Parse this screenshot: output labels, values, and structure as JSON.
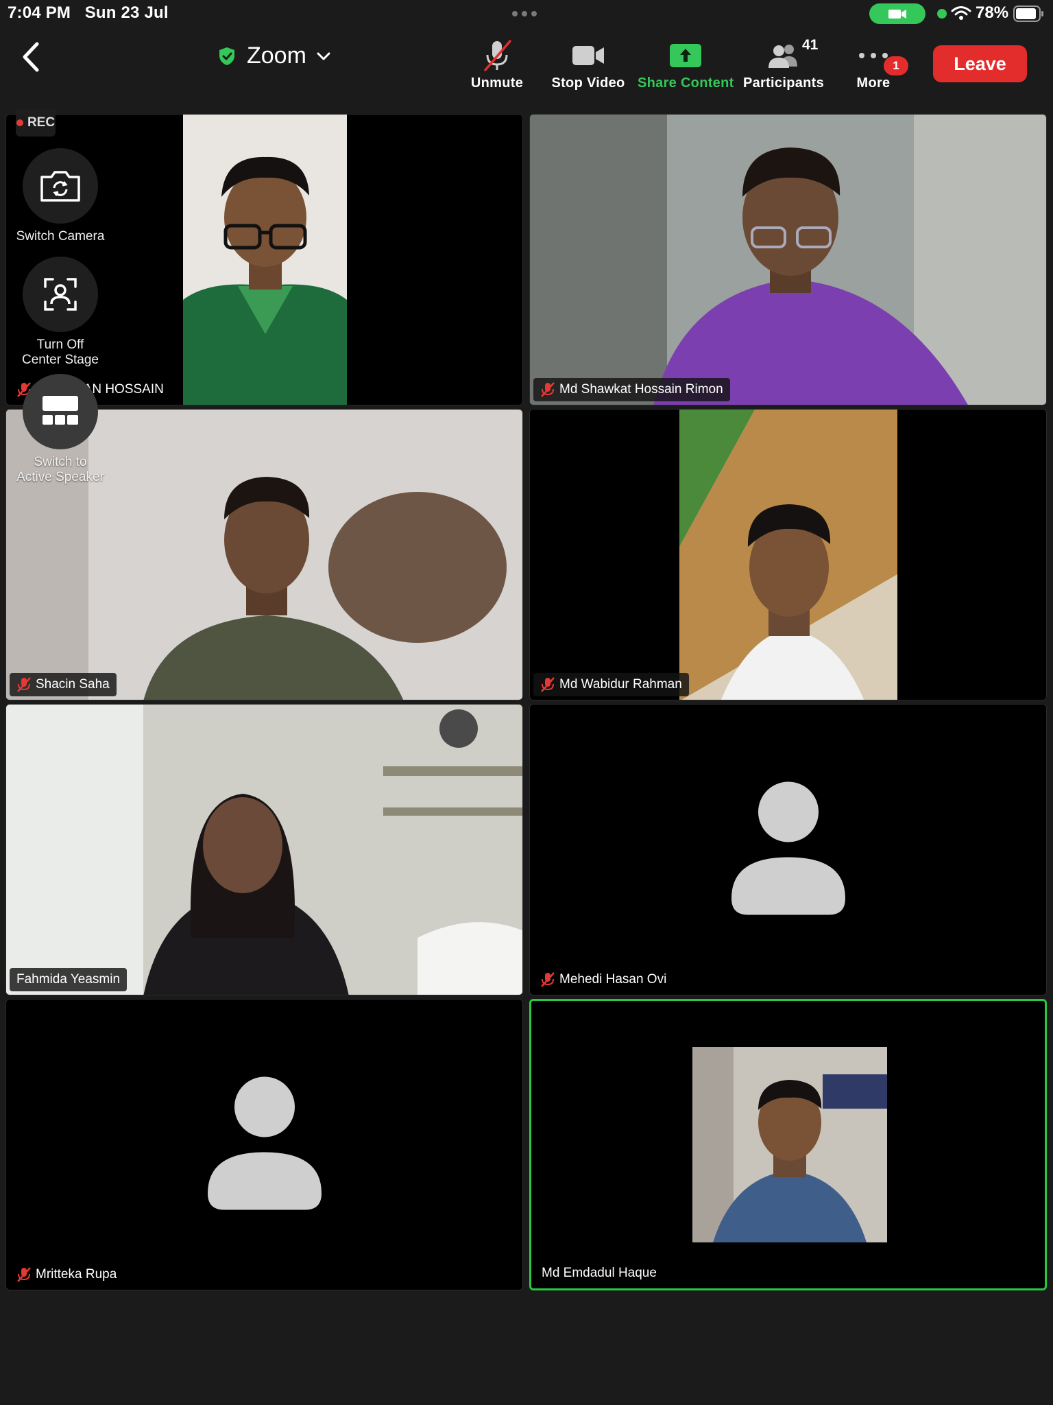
{
  "status_bar": {
    "time": "7:04 PM",
    "date": "Sun 23 Jul",
    "battery": "78%"
  },
  "toolbar": {
    "meeting_title": "Zoom",
    "unmute_label": "Unmute",
    "stop_video_label": "Stop Video",
    "share_content_label": "Share Content",
    "participants_label": "Participants",
    "participants_count": "41",
    "more_label": "More",
    "more_badge": "1",
    "leave_label": "Leave"
  },
  "overlay": {
    "rec_label": "REC",
    "switch_camera_label": "Switch Camera",
    "center_stage_label_1": "Turn Off",
    "center_stage_label_2": "Center Stage",
    "active_speaker_label_1": "Switch to",
    "active_speaker_label_2": "Active Speaker"
  },
  "participants": [
    {
      "name": "MD IMRAN HOSSAIN",
      "muted": true
    },
    {
      "name": "Md Shawkat Hossain Rimon",
      "muted": true
    },
    {
      "name": "Shacin Saha",
      "muted": true
    },
    {
      "name": "Md Wabidur Rahman",
      "muted": true
    },
    {
      "name": "Fahmida Yeasmin",
      "muted": false
    },
    {
      "name": "Mehedi Hasan Ovi",
      "muted": true
    },
    {
      "name": "Mritteka Rupa",
      "muted": true
    },
    {
      "name": "Md Emdadul Haque",
      "muted": false
    }
  ],
  "colors": {
    "accent_green": "#34c759",
    "leave_red": "#e32d2d",
    "active_speaker_border": "#28c840"
  }
}
